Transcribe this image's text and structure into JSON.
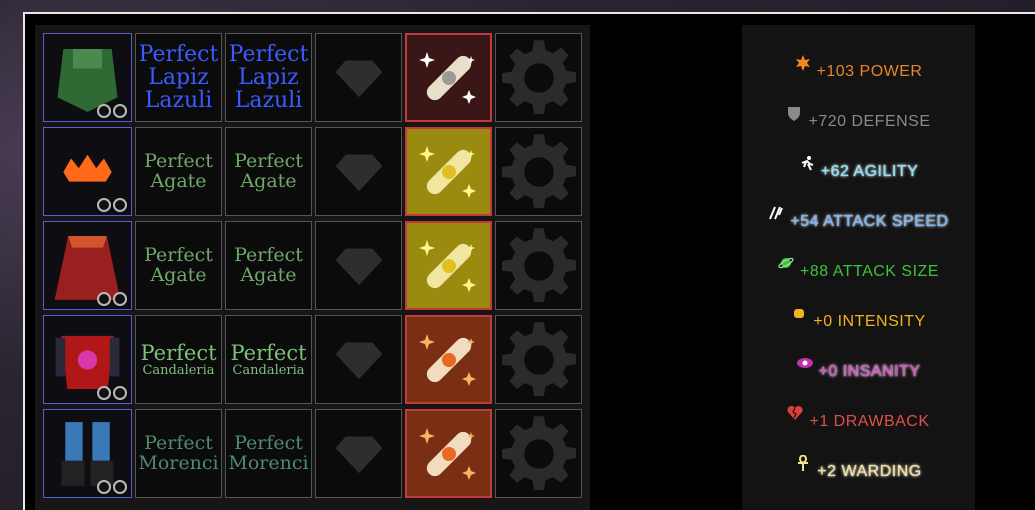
{
  "rows": [
    {
      "item_icon": "green-cloak-icon",
      "gem1": [
        "Perfect",
        "Lapiz",
        "Lazuli"
      ],
      "gem2": [
        "Perfect",
        "Lapiz",
        "Lazuli"
      ],
      "style": "blue",
      "scroll": "silver"
    },
    {
      "item_icon": "orange-crown-icon",
      "gem1": [
        "Perfect",
        "Agate"
      ],
      "gem2": [
        "Perfect",
        "Agate"
      ],
      "style": "green",
      "scroll": "gold"
    },
    {
      "item_icon": "red-cape-icon",
      "gem1": [
        "Perfect",
        "Agate"
      ],
      "gem2": [
        "Perfect",
        "Agate"
      ],
      "style": "green",
      "scroll": "gold"
    },
    {
      "item_icon": "red-armor-icon",
      "gem1": [
        "Perfect",
        "Candaleria"
      ],
      "gem2": [
        "Perfect",
        "Candaleria"
      ],
      "style": "green2",
      "scroll": "orange"
    },
    {
      "item_icon": "blue-boots-icon",
      "gem1": [
        "Perfect",
        "Morenci"
      ],
      "gem2": [
        "Perfect",
        "Morenci"
      ],
      "style": "teal",
      "scroll": "orange"
    }
  ],
  "stats": [
    {
      "icon": "power-star-icon",
      "text": "+103 POWER",
      "color": "#e8842a"
    },
    {
      "icon": "shield-icon",
      "text": "+720 DEFENSE",
      "color": "#8a8a8a"
    },
    {
      "icon": "running-man-icon",
      "text": "+62 AGILITY",
      "color": "#7fe6ff"
    },
    {
      "icon": "speed-slash-icon",
      "text": "+54 ATTACK SPEED",
      "color": "#6fb4ff"
    },
    {
      "icon": "planet-icon",
      "text": "+88 ATTACK SIZE",
      "color": "#3ec23e"
    },
    {
      "icon": "fist-icon",
      "text": "+0 INTENSITY",
      "color": "#f2b21e"
    },
    {
      "icon": "eye-icon",
      "text": "+0 INSANITY",
      "color": "#e040c8"
    },
    {
      "icon": "broken-heart-icon",
      "text": "+1 DRAWBACK",
      "color": "#e0504a"
    },
    {
      "icon": "ankh-icon",
      "text": "+2 WARDING",
      "color": "#f2e08a"
    }
  ]
}
